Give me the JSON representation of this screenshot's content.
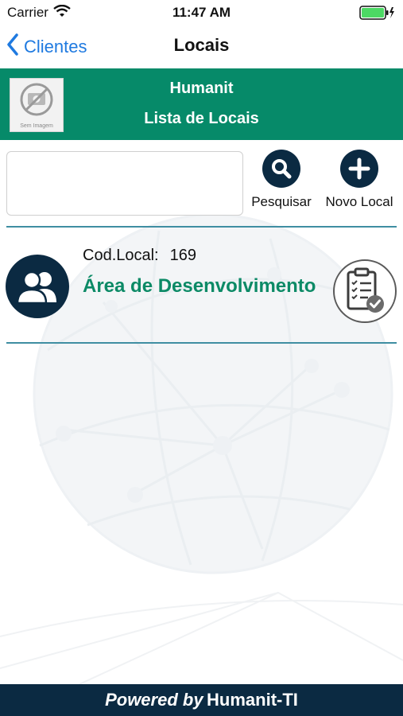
{
  "status_bar": {
    "carrier": "Carrier",
    "time": "11:47 AM",
    "wifi_icon": "wifi-icon",
    "battery_icon": "battery-icon",
    "battery_level": 1.0
  },
  "nav": {
    "back_label": "Clientes",
    "title": "Locais"
  },
  "header": {
    "company_name": "Humanit",
    "list_title": "Lista de Locais",
    "logo_caption": "Sem Imagem",
    "logo_icon": "no-image-icon"
  },
  "search": {
    "value": "",
    "placeholder": ""
  },
  "actions": {
    "search_label": "Pesquisar",
    "search_icon": "magnifier-icon",
    "add_label": "Novo Local",
    "add_icon": "plus-icon"
  },
  "locations": [
    {
      "code_label": "Cod.Local:",
      "code_value": "169",
      "name": "Área de Desenvolvimento",
      "avatar_icon": "users-icon",
      "action_icon": "checklist-icon"
    }
  ],
  "footer": {
    "prefix": "Powered by",
    "brand": "Humanit-TI"
  },
  "colors": {
    "accent_green": "#068a69",
    "navy": "#0b2a42",
    "link_blue": "#1f7ae0",
    "divider_teal": "#3f8ea2",
    "location_green": "#0c8a66"
  }
}
